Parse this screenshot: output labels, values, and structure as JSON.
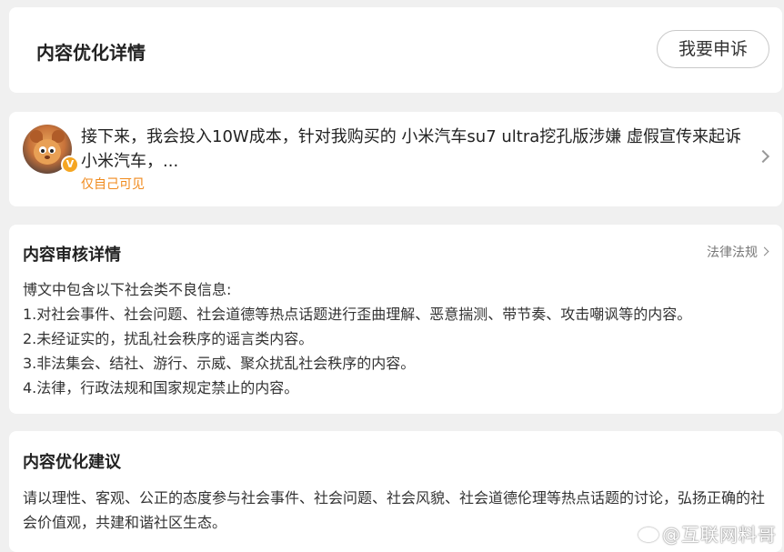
{
  "header": {
    "title": "内容优化详情",
    "appeal_label": "我要申诉"
  },
  "post": {
    "text": "接下来，我会投入10W成本，针对我购买的 小米汽车su7 ultra挖孔版涉嫌 虚假宣传来起诉小米汽车，...",
    "visibility": "仅自己可见",
    "badge": "V"
  },
  "review": {
    "title": "内容审核详情",
    "law_link": "法律法规",
    "lines": [
      "博文中包含以下社会类不良信息:",
      "1.对社会事件、社会问题、社会道德等热点话题进行歪曲理解、恶意揣测、带节奏、攻击嘲讽等的内容。",
      "2.未经证实的，扰乱社会秩序的谣言类内容。",
      "3.非法集会、结社、游行、示威、聚众扰乱社会秩序的内容。",
      "4.法律，行政法规和国家规定禁止的内容。"
    ]
  },
  "suggestion": {
    "title": "内容优化建议",
    "text": "请以理性、客观、公正的态度参与社会事件、社会问题、社会风貌、社会道德伦理等热点话题的讨论，弘扬正确的社会价值观，共建和谐社区生态。"
  },
  "watermark": "@互联网料哥",
  "colors": {
    "background": "#f0f0f0",
    "card": "#ffffff",
    "visibility": "#f08a1c",
    "badge": "#f5a623"
  }
}
